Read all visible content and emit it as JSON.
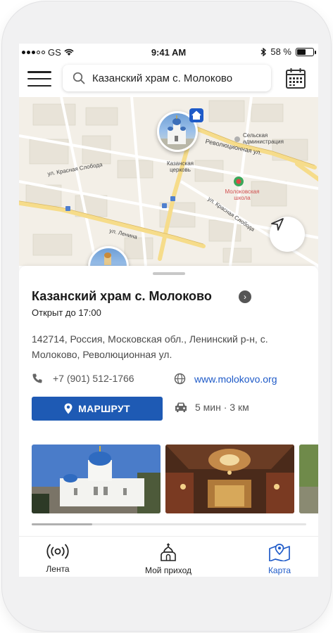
{
  "status_bar": {
    "carrier": "GS",
    "time": "9:41 AM",
    "battery_percent": "58 %",
    "battery_level": 0.58
  },
  "search": {
    "value": "Казанский храм с. Молоково",
    "placeholder": "Казанский храм с. Молоково"
  },
  "map": {
    "labels": {
      "street_revolution": "Революционная ул.",
      "street_lenina": "ул. Ленина",
      "street_krasnaya": "ул. Красная Слобода",
      "street_krasnaya2": "ул. Красная Слобода",
      "admin": "Сельская администрация",
      "school": "Молоковская школа",
      "church": "Казанская церковь"
    }
  },
  "place": {
    "title": "Казанский храм с. Молоково",
    "open_status": "Открыт до 17:00",
    "address": "142714, Россия, Московская обл., Ленинский р-н, с. Молоково, Революционная ул.",
    "phone": "+7 (901) 512-1766",
    "website": "www.molokovo.org",
    "route_label": "МАРШРУТ",
    "eta": "5 мин · 3 км",
    "photos_scroll_fraction": 0.22
  },
  "tabs": [
    {
      "label": "Лента",
      "icon": "radio-broadcast-icon",
      "active": false
    },
    {
      "label": "Мой приход",
      "icon": "church-icon",
      "active": false
    },
    {
      "label": "Карта",
      "icon": "map-pin-icon",
      "active": true
    }
  ],
  "colors": {
    "accent": "#1e5ac8",
    "route_button": "#1e5ab4",
    "map_background": "#f3efe7",
    "road_major": "#f6dc8a"
  }
}
